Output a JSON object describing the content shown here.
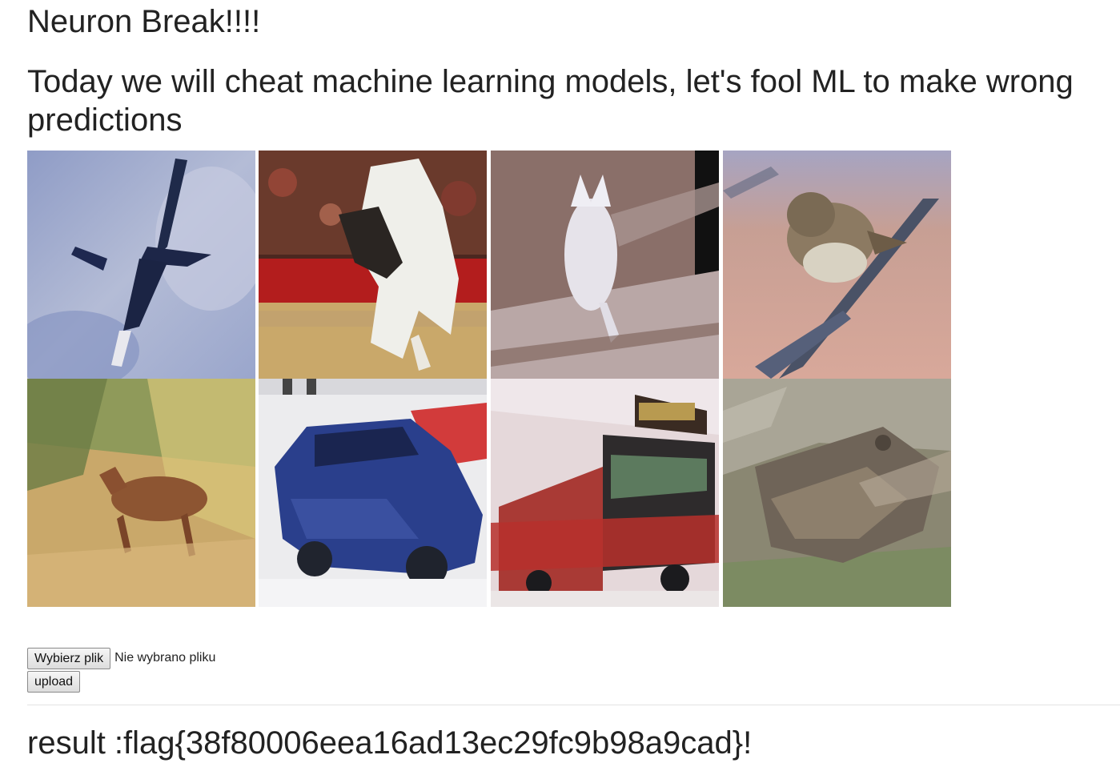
{
  "header": {
    "title": "Neuron Break!!!!",
    "subtitle": "Today we will cheat machine learning models, let's fool ML to make wrong predictions"
  },
  "gallery": {
    "images": [
      {
        "subject": "airplane"
      },
      {
        "subject": "horse"
      },
      {
        "subject": "bird"
      },
      {
        "subject": "bird"
      },
      {
        "subject": "deer"
      },
      {
        "subject": "automobile"
      },
      {
        "subject": "truck"
      },
      {
        "subject": "frog"
      }
    ]
  },
  "form": {
    "choose_file_label": "Wybierz plik",
    "file_status": "Nie wybrano pliku",
    "upload_label": "upload"
  },
  "result": {
    "text": "result :flag{38f80006eea16ad13ec29fc9b98a9cad}!"
  }
}
